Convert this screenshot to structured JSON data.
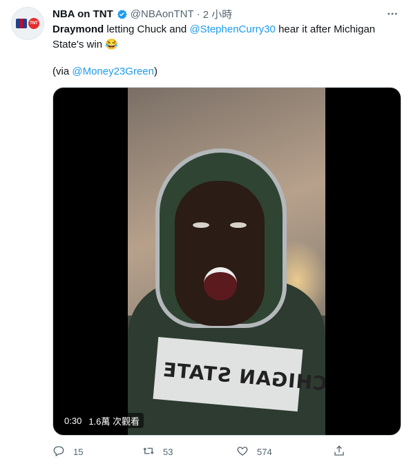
{
  "tweet": {
    "author_name": "NBA on TNT",
    "handle": "@NBAonTNT",
    "separator": "·",
    "time": "2 小時",
    "avatar_text": "TNT",
    "text": {
      "bold_lead": "Draymond",
      "part1": " letting Chuck and ",
      "mention1": "@StephenCurry30",
      "part2": " hear it after Michigan",
      "line2": "State's win 😂",
      "via_open": "(via ",
      "mention2": "@Money23Green",
      "via_close": ")"
    },
    "video": {
      "duration": "0:30",
      "views": "1.6萬 次觀看",
      "shirt_text": "MICHIGAN STATE"
    },
    "actions": {
      "reply_count": "15",
      "retweet_count": "53",
      "like_count": "574"
    }
  },
  "colors": {
    "link": "#1d9bf0",
    "secondary_text": "#536471",
    "verified": "#1d9bf0"
  },
  "icons": [
    "verified-badge-icon",
    "more-icon",
    "reply-icon",
    "retweet-icon",
    "like-icon",
    "share-icon"
  ]
}
